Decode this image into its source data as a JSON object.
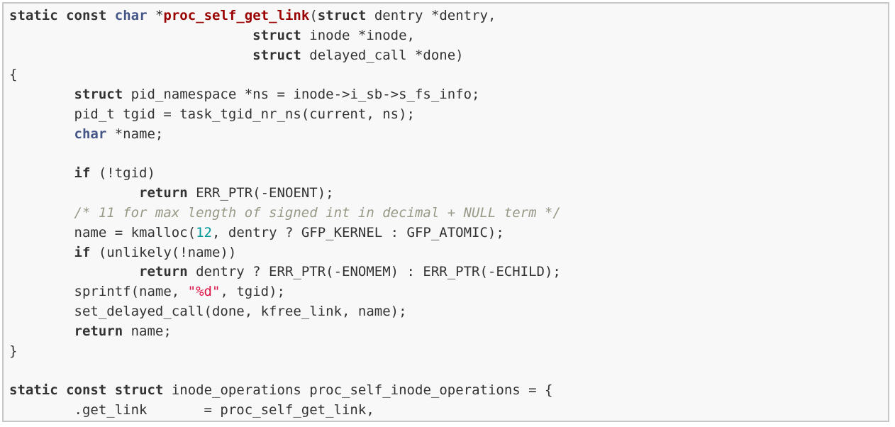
{
  "code": {
    "language": "c",
    "colors": {
      "background": "#f8f8f8",
      "border": "#c6c6c6",
      "text": "#333333",
      "keyword": "#333333",
      "type": "#445588",
      "function_name": "#990000",
      "number": "#009999",
      "string": "#dd1144",
      "comment": "#999988"
    },
    "lines": [
      [
        {
          "t": "kw",
          "v": "static"
        },
        {
          "t": "txt",
          "v": " "
        },
        {
          "t": "kw",
          "v": "const"
        },
        {
          "t": "txt",
          "v": " "
        },
        {
          "t": "type",
          "v": "char"
        },
        {
          "t": "txt",
          "v": " *"
        },
        {
          "t": "fn",
          "v": "proc_self_get_link"
        },
        {
          "t": "txt",
          "v": "("
        },
        {
          "t": "kw",
          "v": "struct"
        },
        {
          "t": "txt",
          "v": " dentry *dentry,"
        }
      ],
      [
        {
          "t": "txt",
          "v": "                              "
        },
        {
          "t": "kw",
          "v": "struct"
        },
        {
          "t": "txt",
          "v": " inode *inode,"
        }
      ],
      [
        {
          "t": "txt",
          "v": "                              "
        },
        {
          "t": "kw",
          "v": "struct"
        },
        {
          "t": "txt",
          "v": " delayed_call *done)"
        }
      ],
      [
        {
          "t": "txt",
          "v": "{"
        }
      ],
      [
        {
          "t": "txt",
          "v": "        "
        },
        {
          "t": "kw",
          "v": "struct"
        },
        {
          "t": "txt",
          "v": " pid_namespace *ns = inode->i_sb->s_fs_info;"
        }
      ],
      [
        {
          "t": "txt",
          "v": "        pid_t tgid = task_tgid_nr_ns(current, ns);"
        }
      ],
      [
        {
          "t": "txt",
          "v": "        "
        },
        {
          "t": "type",
          "v": "char"
        },
        {
          "t": "txt",
          "v": " *name;"
        }
      ],
      [
        {
          "t": "txt",
          "v": ""
        }
      ],
      [
        {
          "t": "txt",
          "v": "        "
        },
        {
          "t": "kw",
          "v": "if"
        },
        {
          "t": "txt",
          "v": " (!tgid)"
        }
      ],
      [
        {
          "t": "txt",
          "v": "                "
        },
        {
          "t": "kw",
          "v": "return"
        },
        {
          "t": "txt",
          "v": " ERR_PTR(-ENOENT);"
        }
      ],
      [
        {
          "t": "txt",
          "v": "        "
        },
        {
          "t": "cmt",
          "v": "/* 11 for max length of signed int in decimal + NULL term */"
        }
      ],
      [
        {
          "t": "txt",
          "v": "        name = kmalloc("
        },
        {
          "t": "num",
          "v": "12"
        },
        {
          "t": "txt",
          "v": ", dentry ? GFP_KERNEL : GFP_ATOMIC);"
        }
      ],
      [
        {
          "t": "txt",
          "v": "        "
        },
        {
          "t": "kw",
          "v": "if"
        },
        {
          "t": "txt",
          "v": " (unlikely(!name))"
        }
      ],
      [
        {
          "t": "txt",
          "v": "                "
        },
        {
          "t": "kw",
          "v": "return"
        },
        {
          "t": "txt",
          "v": " dentry ? ERR_PTR(-ENOMEM) : ERR_PTR(-ECHILD);"
        }
      ],
      [
        {
          "t": "txt",
          "v": "        sprintf(name, "
        },
        {
          "t": "str",
          "v": "\"%d\""
        },
        {
          "t": "txt",
          "v": ", tgid);"
        }
      ],
      [
        {
          "t": "txt",
          "v": "        set_delayed_call(done, kfree_link, name);"
        }
      ],
      [
        {
          "t": "txt",
          "v": "        "
        },
        {
          "t": "kw",
          "v": "return"
        },
        {
          "t": "txt",
          "v": " name;"
        }
      ],
      [
        {
          "t": "txt",
          "v": "}"
        }
      ],
      [
        {
          "t": "txt",
          "v": ""
        }
      ],
      [
        {
          "t": "kw",
          "v": "static"
        },
        {
          "t": "txt",
          "v": " "
        },
        {
          "t": "kw",
          "v": "const"
        },
        {
          "t": "txt",
          "v": " "
        },
        {
          "t": "kw",
          "v": "struct"
        },
        {
          "t": "txt",
          "v": " inode_operations proc_self_inode_operations = {"
        }
      ],
      [
        {
          "t": "txt",
          "v": "        .get_link       = proc_self_get_link,"
        }
      ],
      [
        {
          "t": "txt",
          "v": "};"
        }
      ]
    ]
  }
}
